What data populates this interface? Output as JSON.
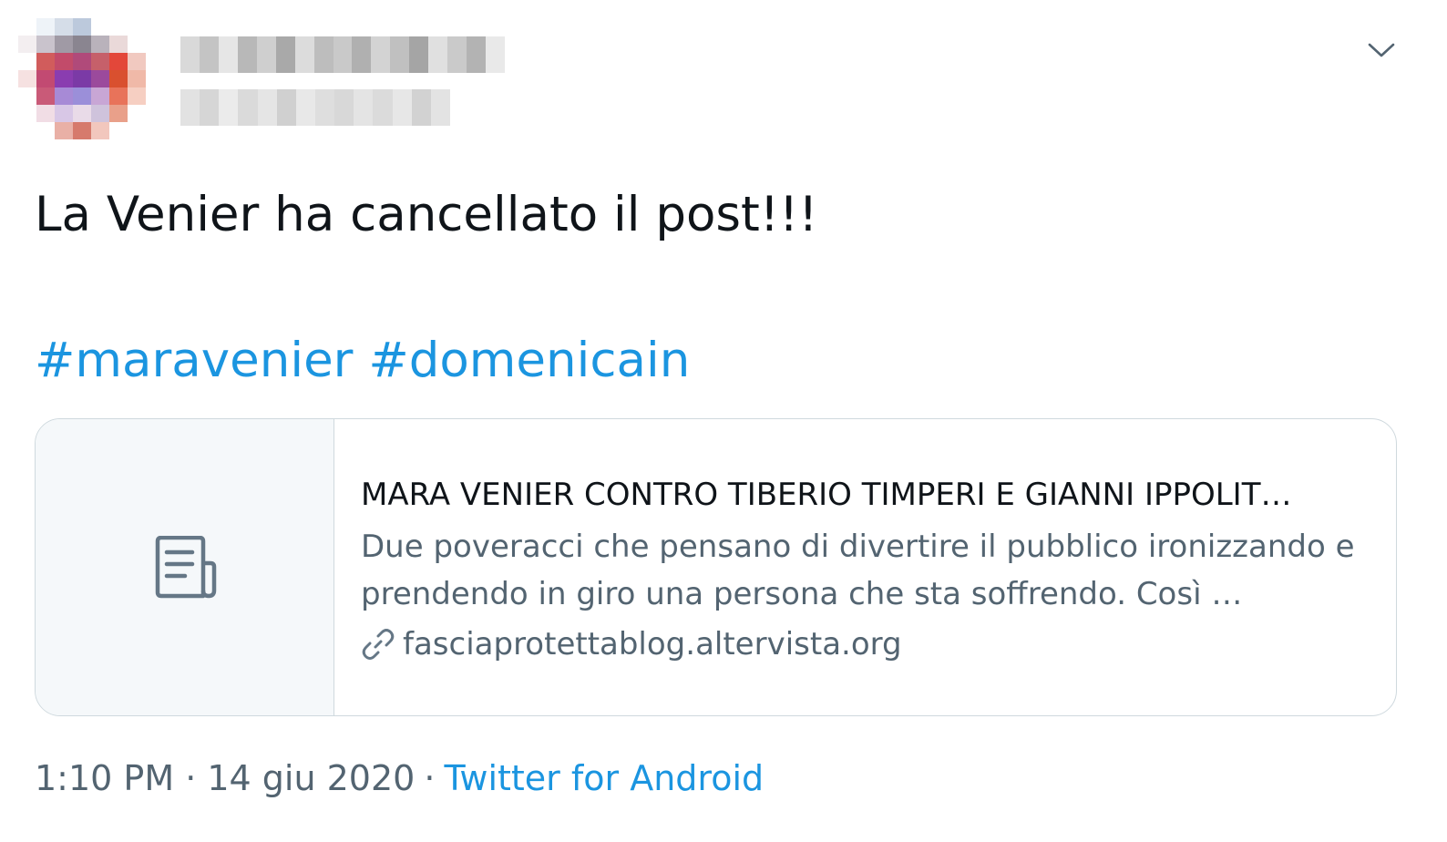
{
  "tweet": {
    "text": "La Venier ha cancellato il post!!!",
    "hashtags": [
      "#maravenier",
      "#domenicain"
    ],
    "timestamp": "1:10 PM · 14 giu 2020",
    "separator": "·",
    "source": "Twitter for Android"
  },
  "card": {
    "title": "MARA VENIER CONTRO TIBERIO TIMPERI E GIANNI IPPOLIT…",
    "description": "Due poveracci che pensano di divertire il pubblico ironizzando e prendendo in giro una persona che sta soffrendo. Così …",
    "domain": "fasciaprotettablog.altervista.org",
    "thumb_icon": "article-icon",
    "domain_icon": "link-icon"
  },
  "header": {
    "menu_icon": "chevron-down-icon"
  },
  "colors": {
    "accent": "#1b95e0",
    "text": "#0f1419",
    "secondary": "#536471",
    "border": "#cfd9de",
    "card_thumb_bg": "#f5f8fa"
  }
}
